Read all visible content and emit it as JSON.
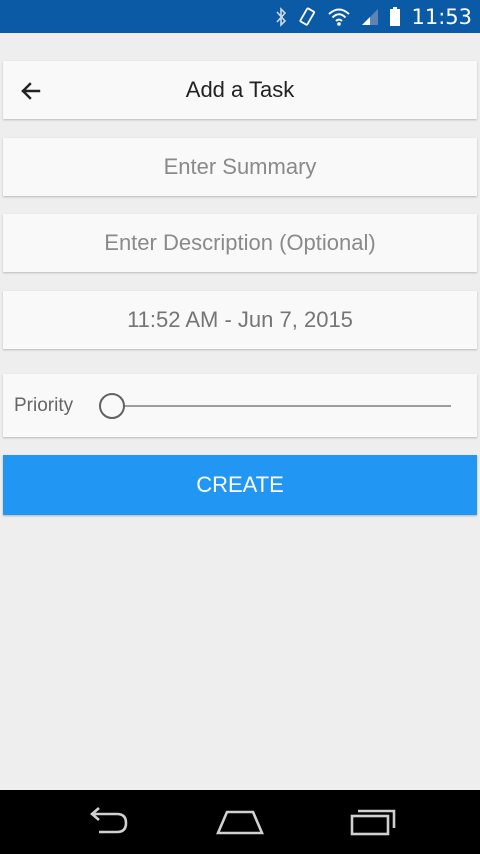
{
  "status_bar": {
    "time": "11:53",
    "icons": [
      "bluetooth-icon",
      "rotation-icon",
      "wifi-icon",
      "signal-icon",
      "battery-icon"
    ]
  },
  "header": {
    "back_icon": "arrow-left-icon",
    "title": "Add a Task"
  },
  "form": {
    "summary": {
      "value": "",
      "placeholder": "Enter Summary"
    },
    "description": {
      "value": "",
      "placeholder": "Enter Description (Optional)"
    },
    "datetime": "11:52 AM - Jun 7, 2015",
    "priority": {
      "label": "Priority",
      "value": 0
    }
  },
  "create_button": {
    "label": "CREATE"
  },
  "nav_bar": {
    "icons": [
      "back-icon",
      "home-icon",
      "recents-icon"
    ]
  },
  "colors": {
    "status_bar": "#0b5aa6",
    "accent": "#2196f3",
    "background": "#eeeeee",
    "card": "#f9f9f9"
  }
}
